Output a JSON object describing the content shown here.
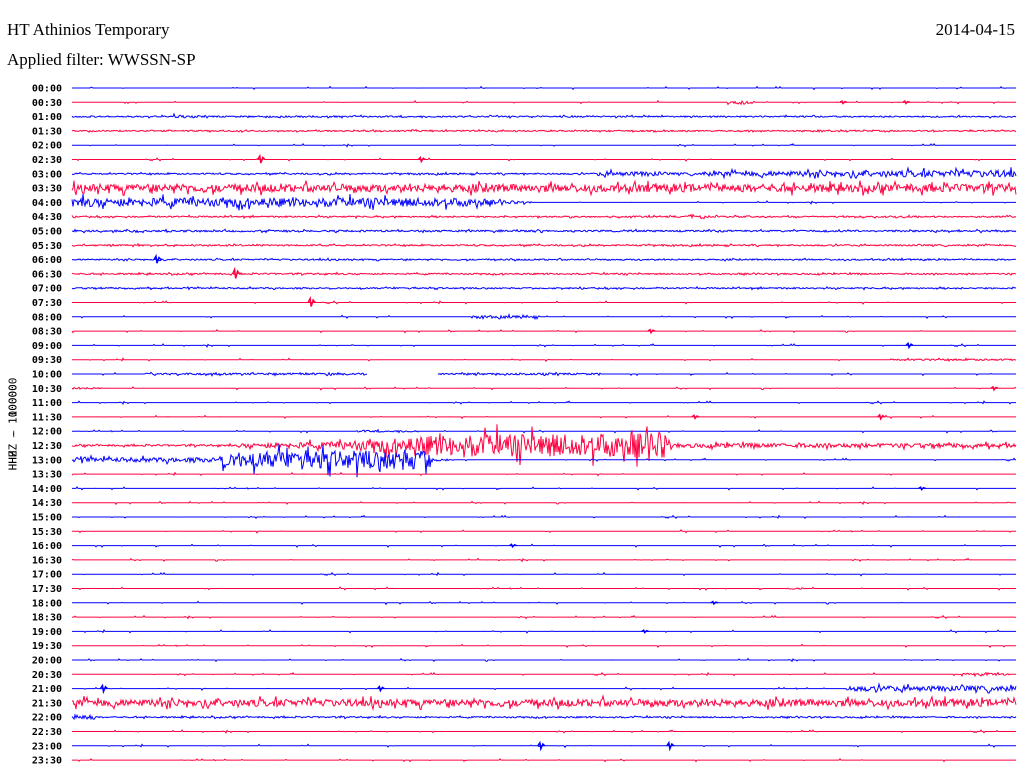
{
  "header": {
    "station": "HT Athinios Temporary",
    "date": "2014-04-15",
    "filter": "Applied filter: WWSSN-SP",
    "channel_label": "HHZ  –  100000"
  },
  "chart_data": {
    "type": "line",
    "title": "HT Athinios Temporary",
    "subtitle": "Applied filter: WWSSN-SP",
    "ylabel": "HHZ - 100000",
    "minutes_per_row": 30,
    "colors": {
      "even": "#0000ff",
      "odd": "#ff0040"
    },
    "baseline_amplitude": 0.6,
    "rows": [
      {
        "label": "00:00",
        "segments": [],
        "spikes": []
      },
      {
        "label": "00:30",
        "segments": [
          [
            20.8,
            21.7,
            1.8,
            1.8
          ]
        ],
        "spikes": [
          [
            24.5,
            1.2
          ],
          [
            26.5,
            1.2
          ]
        ]
      },
      {
        "label": "01:00",
        "segments": [
          [
            0,
            30,
            1.0,
            1.0
          ],
          [
            3.2,
            3.6,
            2.0,
            2.0
          ]
        ],
        "spikes": []
      },
      {
        "label": "01:30",
        "segments": [
          [
            0,
            30,
            0.9,
            0.9
          ]
        ],
        "spikes": []
      },
      {
        "label": "02:00",
        "segments": [],
        "spikes": []
      },
      {
        "label": "02:30",
        "segments": [],
        "spikes": [
          [
            6.0,
            3.5
          ],
          [
            11.1,
            2
          ]
        ]
      },
      {
        "label": "03:00",
        "segments": [
          [
            0,
            30,
            1.0,
            1.0
          ],
          [
            16.7,
            18.7,
            3,
            3
          ],
          [
            18.7,
            20,
            1.5,
            1.5
          ],
          [
            20,
            30,
            3,
            5
          ]
        ],
        "spikes": []
      },
      {
        "label": "03:30",
        "segments": [
          [
            0,
            30,
            5.5,
            5.5
          ]
        ],
        "spikes": []
      },
      {
        "label": "04:00",
        "segments": [
          [
            0,
            13,
            6,
            6
          ],
          [
            13,
            14.6,
            4,
            1
          ]
        ],
        "spikes": []
      },
      {
        "label": "04:30",
        "segments": [
          [
            0,
            30,
            1.0,
            1.0
          ],
          [
            19.6,
            20.1,
            3,
            3
          ]
        ],
        "spikes": []
      },
      {
        "label": "05:00",
        "segments": [
          [
            0,
            30,
            1.2,
            1.2
          ]
        ],
        "spikes": []
      },
      {
        "label": "05:30",
        "segments": [
          [
            0,
            30,
            1.0,
            1.0
          ]
        ],
        "spikes": []
      },
      {
        "label": "06:00",
        "segments": [
          [
            0,
            30,
            1.0,
            1.0
          ]
        ],
        "spikes": [
          [
            2.7,
            3.5
          ]
        ]
      },
      {
        "label": "06:30",
        "segments": [
          [
            0,
            30,
            1.0,
            1.0
          ]
        ],
        "spikes": [
          [
            5.2,
            4.5
          ]
        ]
      },
      {
        "label": "07:00",
        "segments": [
          [
            0,
            30,
            1.0,
            1.0
          ]
        ],
        "spikes": []
      },
      {
        "label": "07:30",
        "segments": [],
        "spikes": [
          [
            7.6,
            4
          ]
        ]
      },
      {
        "label": "08:00",
        "segments": [
          [
            12.7,
            14.8,
            1.6,
            1.6
          ]
        ],
        "spikes": []
      },
      {
        "label": "08:30",
        "segments": [],
        "spikes": [
          [
            18.4,
            1.5
          ]
        ]
      },
      {
        "label": "09:00",
        "segments": [],
        "spikes": [
          [
            26.6,
            2
          ]
        ]
      },
      {
        "label": "09:30",
        "segments": [
          [
            26,
            30,
            1.2,
            1.2
          ]
        ],
        "spikes": []
      },
      {
        "label": "10:00",
        "segments": [
          [
            2.3,
            9.4,
            1.3,
            1.3
          ],
          [
            9.4,
            11.6,
            0,
            0
          ],
          [
            11.6,
            16.8,
            1.2,
            1.2
          ]
        ],
        "spikes": []
      },
      {
        "label": "10:30",
        "segments": [
          [
            0,
            1,
            1.2,
            1.2
          ]
        ],
        "spikes": [
          [
            29.3,
            1.5
          ]
        ]
      },
      {
        "label": "11:00",
        "segments": [],
        "spikes": []
      },
      {
        "label": "11:30",
        "segments": [],
        "spikes": [
          [
            19.8,
            1.5
          ],
          [
            25.7,
            2
          ]
        ]
      },
      {
        "label": "12:00",
        "segments": [
          [
            9,
            11,
            1.2,
            1.2
          ]
        ],
        "spikes": []
      },
      {
        "label": "12:30",
        "segments": [
          [
            0,
            5.3,
            1.2,
            1.2
          ],
          [
            5.3,
            8.5,
            3,
            5
          ],
          [
            8.5,
            11.1,
            6,
            12
          ],
          [
            11.1,
            19,
            14,
            18
          ],
          [
            19,
            30,
            3,
            3
          ]
        ],
        "spikes": []
      },
      {
        "label": "13:00",
        "segments": [
          [
            0,
            4.7,
            3,
            3
          ],
          [
            4.7,
            11.4,
            11,
            14
          ],
          [
            11.4,
            12,
            3,
            1
          ]
        ],
        "spikes": []
      },
      {
        "label": "13:30",
        "segments": [],
        "spikes": []
      },
      {
        "label": "14:00",
        "segments": [],
        "spikes": [
          [
            27,
            1.2
          ]
        ]
      },
      {
        "label": "14:30",
        "segments": [],
        "spikes": []
      },
      {
        "label": "15:00",
        "segments": [],
        "spikes": []
      },
      {
        "label": "15:30",
        "segments": [],
        "spikes": []
      },
      {
        "label": "16:00",
        "segments": [],
        "spikes": [
          [
            14,
            1.2
          ]
        ]
      },
      {
        "label": "16:30",
        "segments": [],
        "spikes": []
      },
      {
        "label": "17:00",
        "segments": [],
        "spikes": []
      },
      {
        "label": "17:30",
        "segments": [
          [
            22.7,
            23.3,
            1.2,
            1.2
          ]
        ],
        "spikes": []
      },
      {
        "label": "18:00",
        "segments": [],
        "spikes": [
          [
            20.4,
            1.2
          ]
        ]
      },
      {
        "label": "18:30",
        "segments": [],
        "spikes": []
      },
      {
        "label": "19:00",
        "segments": [],
        "spikes": [
          [
            18.2,
            1.2
          ]
        ]
      },
      {
        "label": "19:30",
        "segments": [],
        "spikes": []
      },
      {
        "label": "20:00",
        "segments": [],
        "spikes": []
      },
      {
        "label": "20:30",
        "segments": [
          [
            28.2,
            29.8,
            1.5,
            1.5
          ]
        ],
        "spikes": []
      },
      {
        "label": "21:00",
        "segments": [
          [
            24.6,
            30,
            3.5,
            3.5
          ]
        ],
        "spikes": [
          [
            1,
            3
          ],
          [
            9.8,
            2
          ]
        ]
      },
      {
        "label": "21:30",
        "segments": [
          [
            0,
            30,
            5,
            5
          ]
        ],
        "spikes": []
      },
      {
        "label": "22:00",
        "segments": [
          [
            0,
            0.7,
            3.5,
            3.5
          ],
          [
            0.7,
            30,
            1.0,
            1.0
          ]
        ],
        "spikes": []
      },
      {
        "label": "22:30",
        "segments": [],
        "spikes": []
      },
      {
        "label": "23:00",
        "segments": [],
        "spikes": [
          [
            14.9,
            3
          ],
          [
            19,
            3
          ]
        ]
      },
      {
        "label": "23:30",
        "segments": [],
        "spikes": []
      }
    ]
  }
}
